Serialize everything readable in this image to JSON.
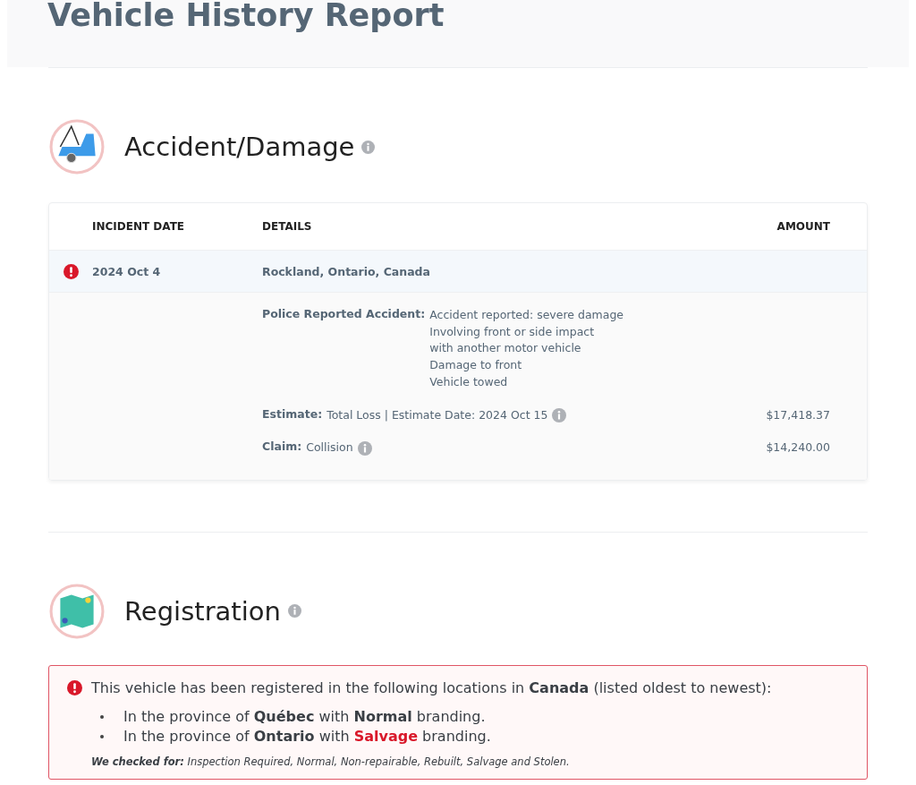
{
  "header": {
    "title": "Vehicle History Report"
  },
  "accident": {
    "title": "Accident/Damage",
    "table": {
      "columns": [
        "INCIDENT DATE",
        "DETAILS",
        "AMOUNT"
      ],
      "incidents": [
        {
          "alert": true,
          "date": "2024 Oct 4",
          "location": "Rockland, Ontario, Canada",
          "details": [
            {
              "label": "Police Reported Accident:",
              "lines": [
                "Accident reported: severe damage",
                "Involving front or side impact",
                "with another motor vehicle",
                "Damage to front",
                "Vehicle towed"
              ],
              "info": false
            },
            {
              "label": "Estimate:",
              "lines": [
                "Total Loss | Estimate Date: 2024 Oct 15"
              ],
              "info": true,
              "amount": "$17,418.37"
            },
            {
              "label": "Claim:",
              "lines": [
                "Collision"
              ],
              "info": true,
              "amount": "$14,240.00"
            }
          ]
        }
      ]
    }
  },
  "registration": {
    "title": "Registration",
    "notice": {
      "alert": true,
      "text": "This vehicle has been registered in the following locations in **Canada** (listed oldest to newest):",
      "items": [
        {
          "before": "In the province of ",
          "province": "Québec",
          "middle": " with ",
          "branding": "Normal",
          "after": " branding.",
          "branding_alert": false
        },
        {
          "before": "In the province of ",
          "province": "Ontario",
          "middle": " with ",
          "branding": "Salvage",
          "after": " branding.",
          "branding_alert": true
        }
      ],
      "checked_label": "We checked for:",
      "checked_list": "Inspection Required, Normal, Non-repairable, Rebuilt, Salvage and Stolen."
    }
  }
}
